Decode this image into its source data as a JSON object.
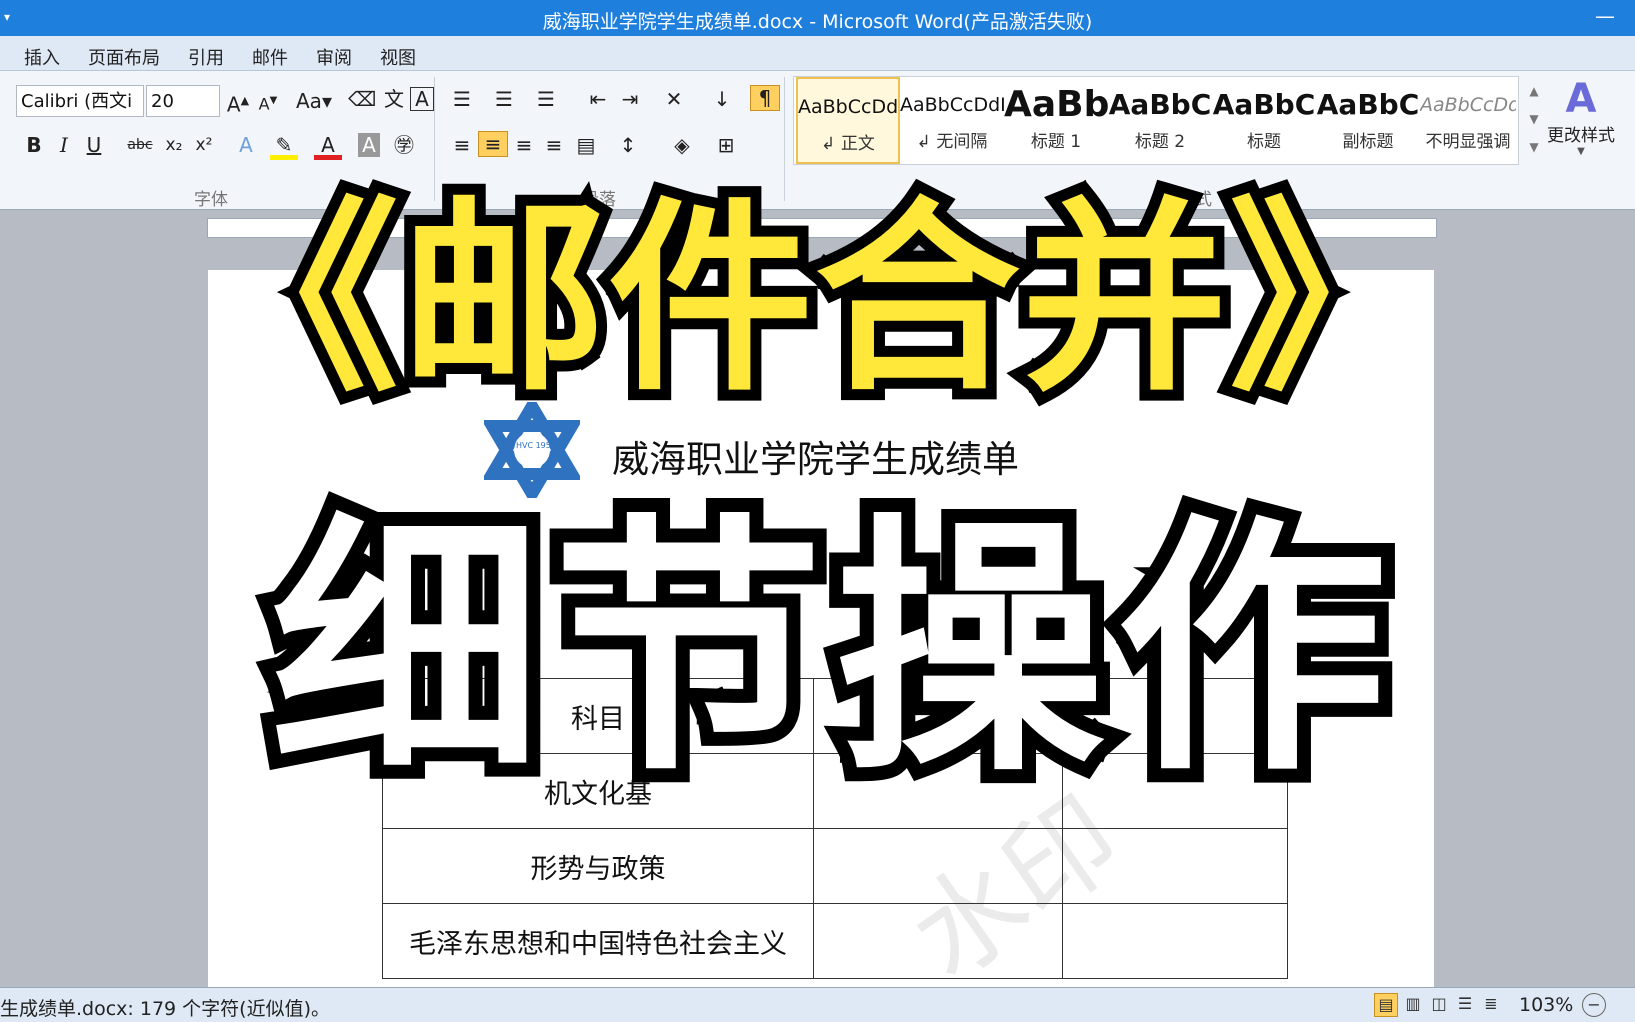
{
  "window": {
    "title": "威海职业学院学生成绩单.docx - Microsoft Word(产品激活失败)"
  },
  "tabs": [
    "插入",
    "页面布局",
    "引用",
    "邮件",
    "审阅",
    "视图"
  ],
  "ribbon": {
    "font_name": "Calibri (西文i",
    "font_size": "20",
    "groups": {
      "font": "字体",
      "paragraph": "段落",
      "styles": "样式"
    },
    "styles": [
      {
        "sample": "AaBbCcDdI",
        "label": "↲ 正文"
      },
      {
        "sample": "AaBbCcDdI",
        "label": "↲ 无间隔"
      },
      {
        "sample": "AaBb",
        "label": "标题 1"
      },
      {
        "sample": "AaBbC",
        "label": "标题 2"
      },
      {
        "sample": "AaBbC",
        "label": "标题"
      },
      {
        "sample": "AaBbC",
        "label": "副标题"
      },
      {
        "sample": "AaBbCcDd",
        "label": "不明显强调"
      }
    ],
    "change_styles": "更改样式"
  },
  "document": {
    "title": "威海职业学院学生成绩单",
    "logo_text": "WHVC 1958",
    "table_rows": [
      [
        "科目",
        "",
        ""
      ],
      [
        "机文化基",
        "",
        ""
      ],
      [
        "形势与政策",
        "",
        ""
      ],
      [
        "毛泽东思想和中国特色社会主义",
        "",
        ""
      ]
    ]
  },
  "overlay": {
    "headline": "《邮件合并》",
    "subline": "细节操作"
  },
  "status": {
    "left": "生成绩单.docx: 179 个字符(近似值)。",
    "zoom": "103%"
  }
}
